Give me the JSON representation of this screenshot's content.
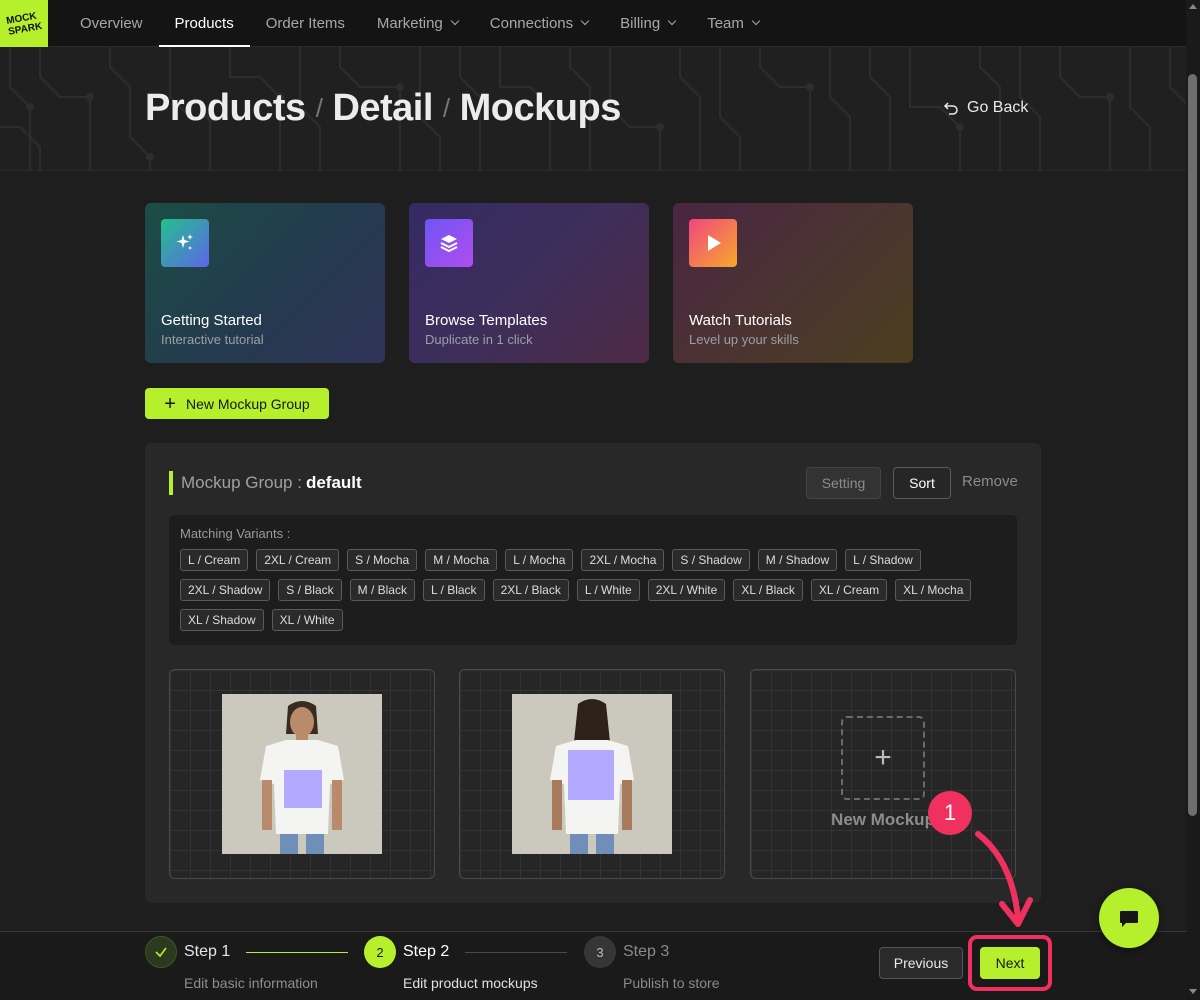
{
  "nav": {
    "logo_text_1": "MOCK",
    "logo_text_2": "SPARK",
    "items": [
      {
        "label": "Overview"
      },
      {
        "label": "Products"
      },
      {
        "label": "Order Items"
      },
      {
        "label": "Marketing"
      },
      {
        "label": "Connections"
      },
      {
        "label": "Billing"
      },
      {
        "label": "Team"
      }
    ],
    "active": "Products"
  },
  "header": {
    "breadcrumb": [
      "Products",
      "Detail",
      "Mockups"
    ],
    "separator": "/",
    "go_back": "Go Back"
  },
  "cards": [
    {
      "title": "Getting Started",
      "subtitle": "Interactive tutorial",
      "icon": "sparkles-icon"
    },
    {
      "title": "Browse Templates",
      "subtitle": "Duplicate in 1 click",
      "icon": "layers-icon"
    },
    {
      "title": "Watch Tutorials",
      "subtitle": "Level up your skills",
      "icon": "play-icon"
    }
  ],
  "new_group_button": "New Mockup Group",
  "group": {
    "label": "Mockup Group :",
    "name": "default",
    "setting": "Setting",
    "sort": "Sort",
    "remove": "Remove",
    "variants_label": "Matching Variants :",
    "variants": [
      "L / Cream",
      "2XL / Cream",
      "S / Mocha",
      "M / Mocha",
      "L / Mocha",
      "2XL / Mocha",
      "S / Shadow",
      "M / Shadow",
      "L / Shadow",
      "2XL / Shadow",
      "S / Black",
      "M / Black",
      "L / Black",
      "2XL / Black",
      "L / White",
      "2XL / White",
      "XL / Black",
      "XL / Cream",
      "XL / Mocha",
      "XL / Shadow",
      "XL / White"
    ],
    "new_mockup": "New Mockup"
  },
  "stepper": {
    "steps": [
      {
        "title": "Step 1",
        "desc": "Edit basic information",
        "state": "done"
      },
      {
        "title": "Step 2",
        "desc": "Edit product mockups",
        "state": "active",
        "number": "2"
      },
      {
        "title": "Step 3",
        "desc": "Publish to store",
        "state": "pending",
        "number": "3"
      }
    ],
    "previous": "Previous",
    "next": "Next"
  },
  "annotation": {
    "badge": "1"
  },
  "colors": {
    "accent": "#b6f02d",
    "highlight": "#f0315f",
    "background": "#1e1e1e"
  }
}
